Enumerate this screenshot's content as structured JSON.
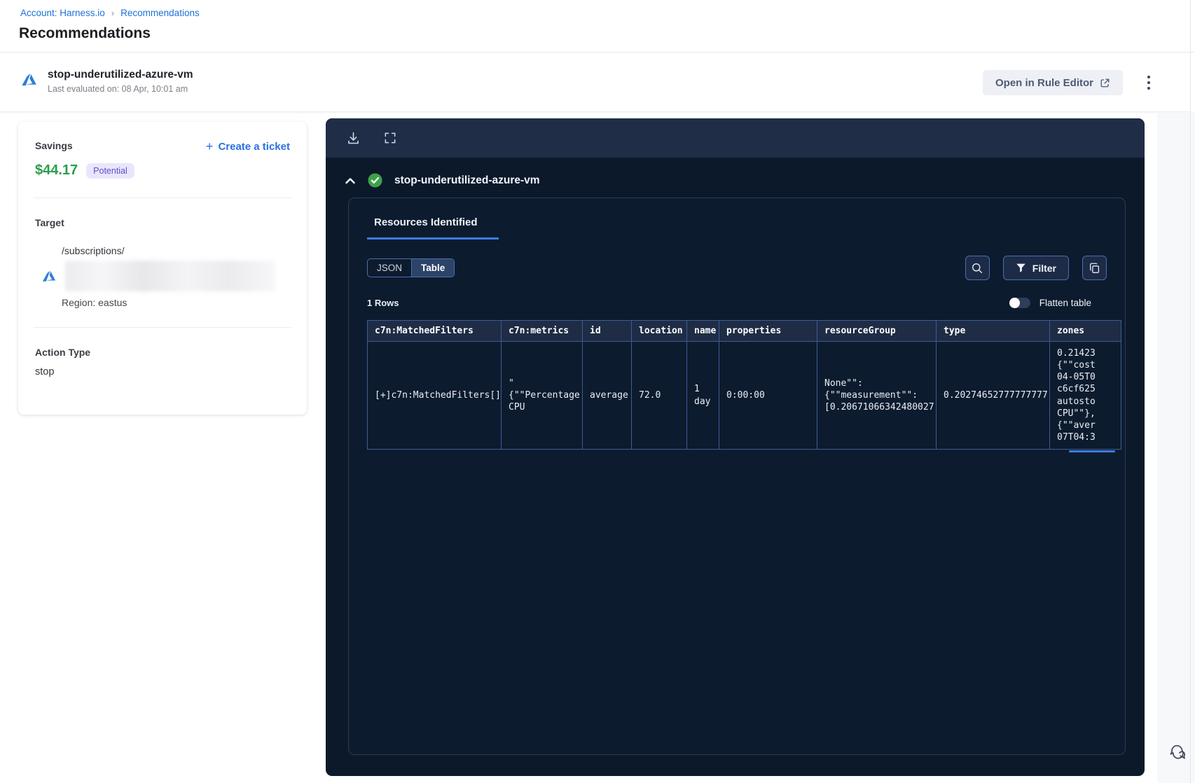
{
  "breadcrumb": {
    "account_link": "Account: Harness.io",
    "separator": "›",
    "current": "Recommendations"
  },
  "page": {
    "title": "Recommendations"
  },
  "recommendation_header": {
    "title": "stop-underutilized-azure-vm",
    "last_evaluated": "Last evaluated on: 08 Apr, 10:01 am",
    "open_rule_editor_label": "Open in Rule Editor"
  },
  "summary_card": {
    "savings_label": "Savings",
    "savings_value": "$44.17",
    "savings_badge": "Potential",
    "create_ticket_label": "Create a ticket",
    "target_label": "Target",
    "target_path": "/subscriptions/",
    "region": "Region: eastus",
    "action_type_label": "Action Type",
    "action_type_value": "stop"
  },
  "results_panel": {
    "title": "stop-underutilized-azure-vm",
    "tab_label": "Resources Identified",
    "json_toggle_label": "JSON",
    "table_toggle_label": "Table",
    "selected_view": "Table",
    "filter_label": "Filter",
    "rows_count": "1 Rows",
    "flatten_toggle_label": "Flatten table",
    "table": {
      "columns": [
        "c7n:MatchedFilters",
        "c7n:metrics",
        "id",
        "location",
        "name",
        "properties",
        "resourceGroup",
        "type",
        "zones"
      ],
      "cells": [
        "[+]c7n:MatchedFilters[]",
        "\"\n{\"\"Percentage\nCPU",
        "average",
        "72.0",
        "1 day",
        "0:00:00",
        "None\"\":\n{\"\"measurement\"\":\n[0.20671066342480027",
        "0.20274652777777777",
        "0.21423\n{\"\"cost\n04-05T0\nc6cf625\nautosto\nCPU\"\"},\n{\"\"aver\n07T04:3"
      ]
    }
  },
  "colors": {
    "link_blue": "#1c71d8",
    "accent_blue": "#3c7ce0",
    "savings_green": "#2b9e4c",
    "badge_purple_text": "#5b50c9",
    "badge_purple_bg": "#e9e6fc",
    "panel_bg": "#0c192b",
    "panel_toolbar_bg": "#1f2d47",
    "table_border_blue": "#3d5c96",
    "matched_filters_teal": "#6cc9c9",
    "success_green": "#3fa14b"
  }
}
